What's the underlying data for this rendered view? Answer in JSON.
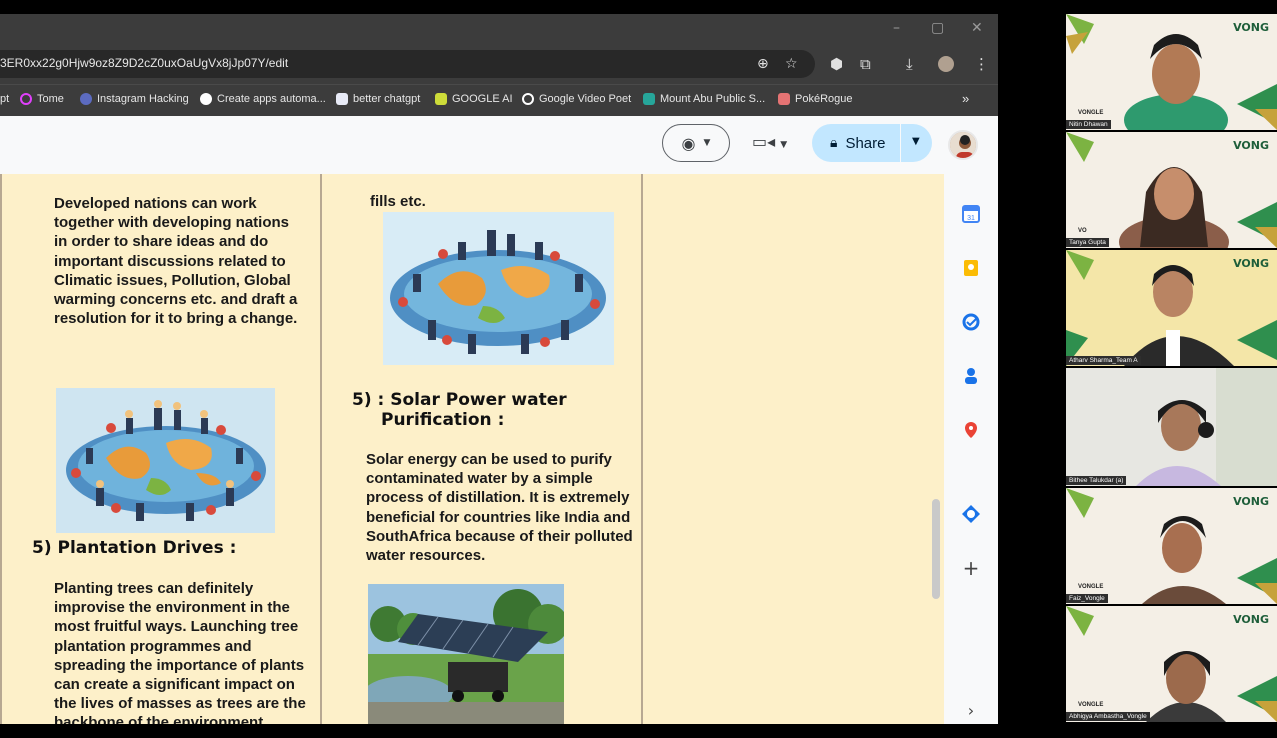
{
  "browser": {
    "window_controls": [
      "–",
      "▢",
      "✕"
    ],
    "url": "3ER0xx22g0Hjw9oz8Z9D2cZ0uxOaUgVx8jJp07Y/edit",
    "bookmarks": [
      {
        "label": "pt",
        "color": ""
      },
      {
        "label": "Tome",
        "color": "#e040fb"
      },
      {
        "label": "Instagram Hacking",
        "color": "#5c6bc0"
      },
      {
        "label": "Create apps automa...",
        "color": "#ffffff"
      },
      {
        "label": "better chatgpt",
        "color": "#ffffff"
      },
      {
        "label": "GOOGLE AI",
        "color": "#cddc39"
      },
      {
        "label": "Google Video Poet",
        "color": "#ffffff"
      },
      {
        "label": "Mount Abu Public S...",
        "color": "#26a69a"
      },
      {
        "label": "PokéRogue",
        "color": "#e57373"
      }
    ],
    "overflow": "»"
  },
  "toolbar": {
    "share_label": "Share",
    "accent_color": "#c2e7ff"
  },
  "document": {
    "col1_paragraph1": "Developed nations can work together with developing nations in order to share ideas and do important discussions related to Climatic issues, Pollution, Global warming concerns etc. and draft a resolution for it to bring a change.",
    "col1_heading": "5) Plantation Drives :",
    "col1_paragraph2": "Planting trees can definitely improvise the environment in the most fruitful ways. Launching tree plantation programmes and spreading the importance of plants can create a significant impact on the lives of masses as trees are the backbone of the environment",
    "col2_top_text": "fills etc.",
    "col2_heading_line1": "5) : Solar Power water",
    "col2_heading_line2": "Purification :",
    "col2_paragraph": "Solar energy can be used to purify contaminated water by a simple process of distillation. It is extremely beneficial for countries like India and SouthAfrica because of their polluted water resources.",
    "page_color": "#fdf0c9"
  },
  "participants": [
    {
      "name": "Nitin Dhawan",
      "vongle": "VONGLE",
      "brand": "VONG"
    },
    {
      "name": "Tanya Gupta",
      "vongle": "VO",
      "brand": "VONG"
    },
    {
      "name": "Atharv Sharma_Team A",
      "vongle": "",
      "brand": "VONG"
    },
    {
      "name": "Bithee Talukdar (a)",
      "vongle": "",
      "brand": ""
    },
    {
      "name": "Faiz_Vongle",
      "vongle": "VONGLE",
      "brand": "VONG"
    },
    {
      "name": "Abhigya Ambastha_Vongle",
      "vongle": "VONGLE",
      "brand": "VONG"
    }
  ]
}
